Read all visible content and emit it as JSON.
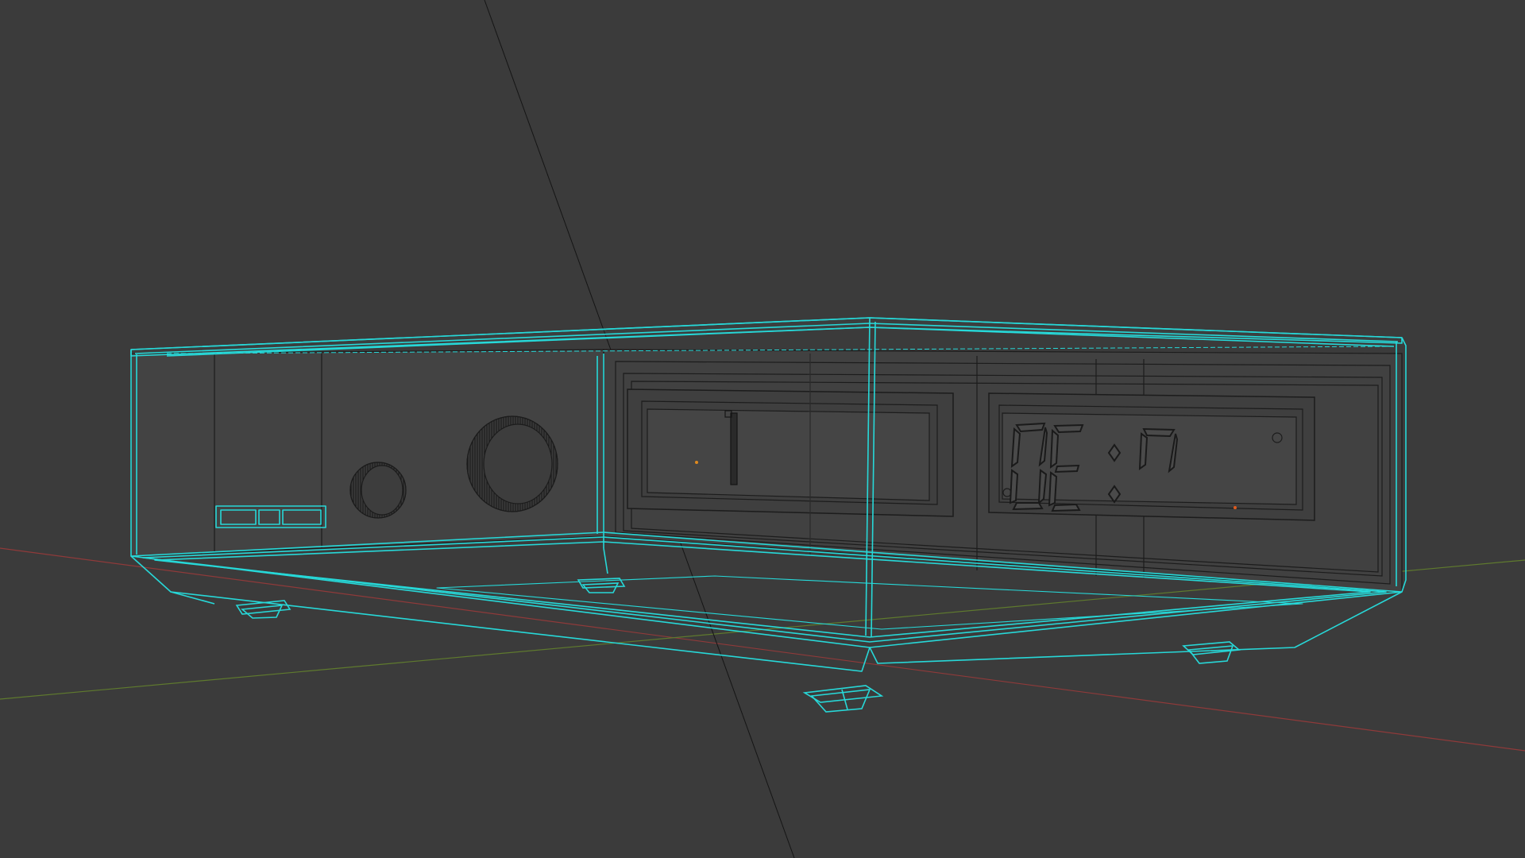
{
  "viewport": {
    "background": "#3b3b3b",
    "selection_wire_color": "#27d8d8",
    "inner_wire_color": "#1c1c1c",
    "axis_x_color": "#8f3a3a",
    "axis_y_color": "#5f7a2e",
    "origin_dot_color": "#e08a1e"
  },
  "scene": {
    "object": "alarm-clock-housing",
    "mode": "wireframe",
    "display_digits": "OE:7",
    "selected_parts": [
      "outer-shell",
      "top-panel",
      "bottom-frame",
      "feet"
    ]
  }
}
